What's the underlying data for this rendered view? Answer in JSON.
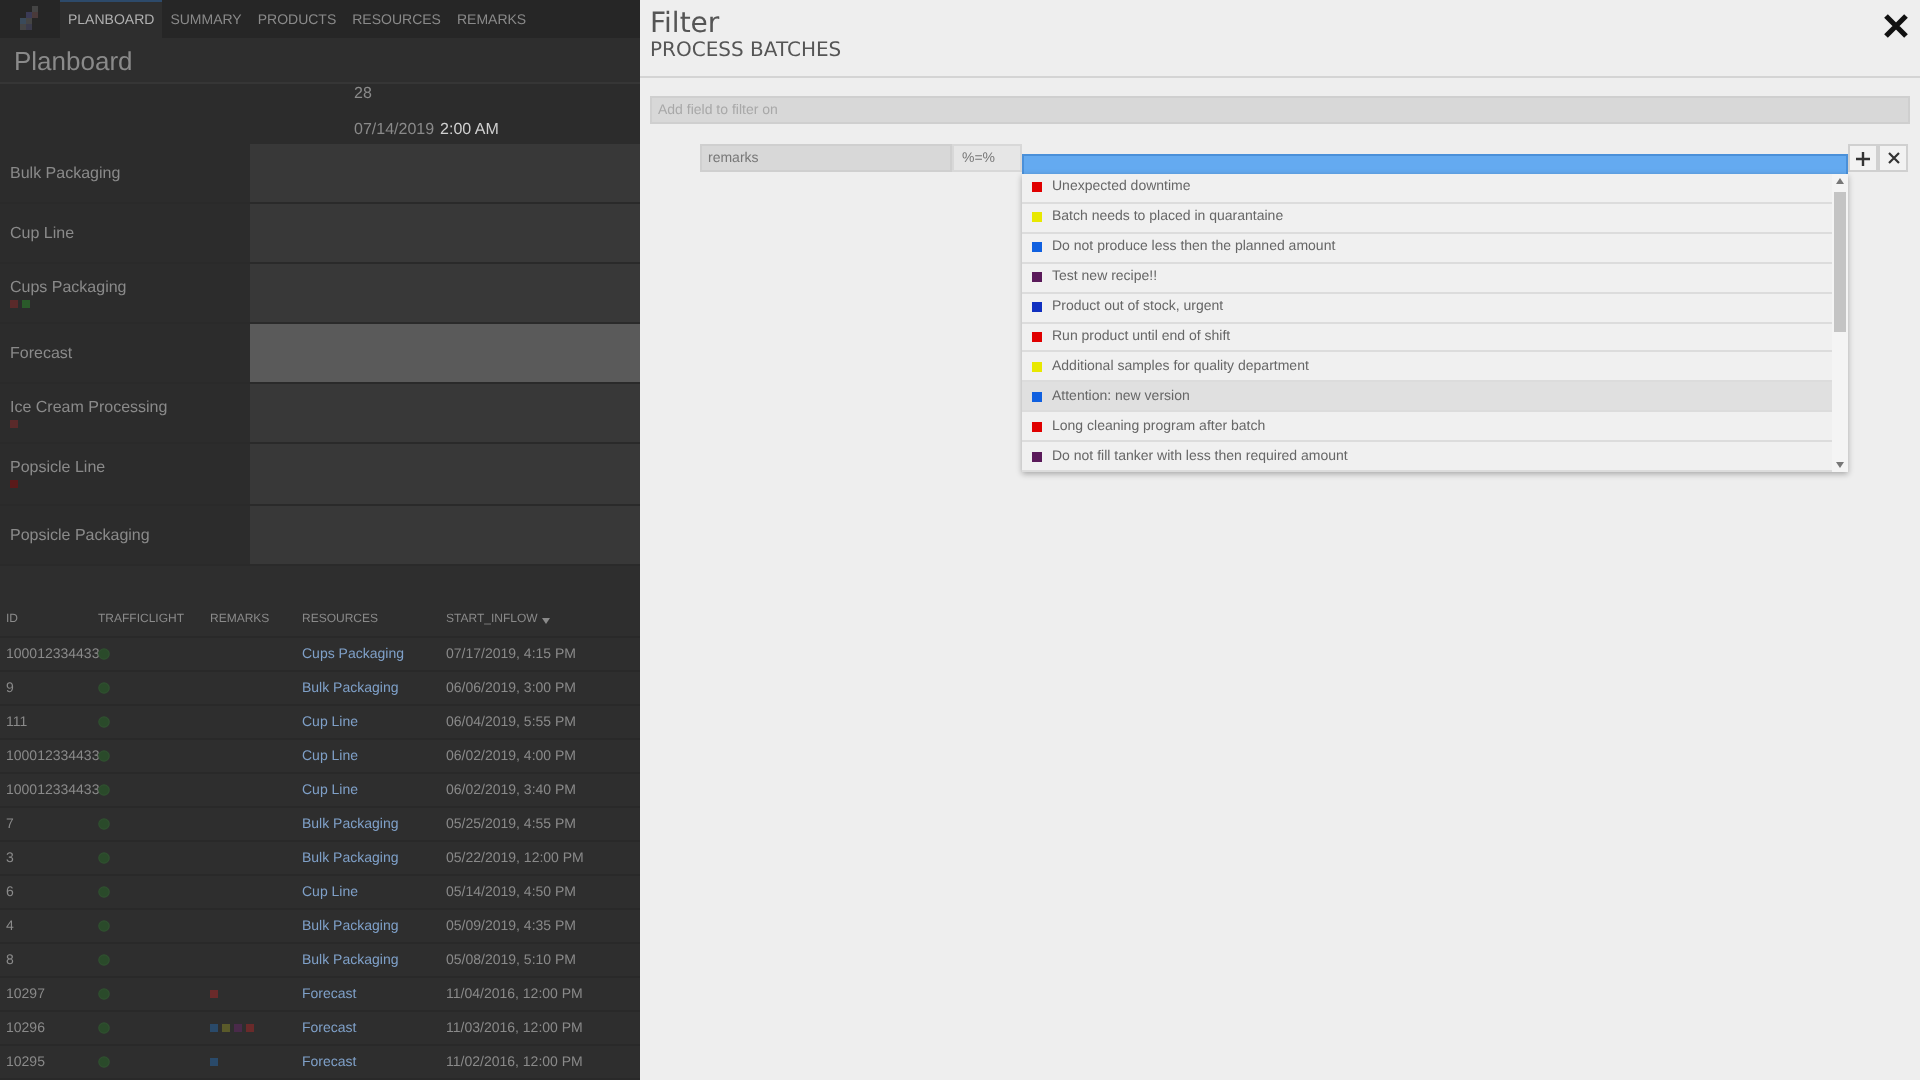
{
  "app": {
    "tabs": [
      {
        "label": "PLANBOARD",
        "selected": true
      },
      {
        "label": "SUMMARY",
        "selected": false
      },
      {
        "label": "PRODUCTS",
        "selected": false
      },
      {
        "label": "RESOURCES",
        "selected": false
      },
      {
        "label": "REMARKS",
        "selected": false
      }
    ],
    "title": "Planboard",
    "timeline": {
      "day": "28",
      "date": "07/14/2019",
      "time": "2:00 AM"
    },
    "resources": [
      {
        "name": "Bulk Packaging",
        "highlighted": false
      },
      {
        "name": "Cup Line",
        "highlighted": false
      },
      {
        "name": "Cups Packaging",
        "highlighted": false,
        "marks": [
          {
            "color": "#5a2a2a"
          },
          {
            "color": "#2a5a2a"
          }
        ]
      },
      {
        "name": "Forecast",
        "highlighted": true
      },
      {
        "name": "Ice Cream Processing",
        "highlighted": false,
        "marks": [
          {
            "color": "#5a2a2a"
          }
        ]
      },
      {
        "name": "Popsicle Line",
        "highlighted": false,
        "marks": [
          {
            "color": "#5a1a1a"
          }
        ]
      },
      {
        "name": "Popsicle Packaging",
        "highlighted": false
      }
    ],
    "table": {
      "columns": [
        {
          "label": "ID",
          "sorted": false
        },
        {
          "label": "TRAFFICLIGHT",
          "sorted": false
        },
        {
          "label": "REMARKS",
          "sorted": false
        },
        {
          "label": "RESOURCES",
          "sorted": false
        },
        {
          "label": "START_INFLOW",
          "sorted": true
        }
      ],
      "rows": [
        {
          "id": "100012334433",
          "remarks": [],
          "resource": "Cups Packaging",
          "start": "07/17/2019, 4:15 PM"
        },
        {
          "id": "9",
          "remarks": [],
          "resource": "Bulk Packaging",
          "start": "06/06/2019, 3:00 PM"
        },
        {
          "id": "111",
          "remarks": [],
          "resource": "Cup Line",
          "start": "06/04/2019, 5:55 PM"
        },
        {
          "id": "100012334433",
          "remarks": [],
          "resource": "Cup Line",
          "start": "06/02/2019, 4:00 PM"
        },
        {
          "id": "100012334433",
          "remarks": [],
          "resource": "Cup Line",
          "start": "06/02/2019, 3:40 PM"
        },
        {
          "id": "7",
          "remarks": [],
          "resource": "Bulk Packaging",
          "start": "05/25/2019, 4:55 PM"
        },
        {
          "id": "3",
          "remarks": [],
          "resource": "Bulk Packaging",
          "start": "05/22/2019, 12:00 PM"
        },
        {
          "id": "6",
          "remarks": [],
          "resource": "Cup Line",
          "start": "05/14/2019, 4:50 PM"
        },
        {
          "id": "4",
          "remarks": [],
          "resource": "Bulk Packaging",
          "start": "05/09/2019, 4:35 PM"
        },
        {
          "id": "8",
          "remarks": [],
          "resource": "Bulk Packaging",
          "start": "05/08/2019, 5:10 PM"
        },
        {
          "id": "10297",
          "remarks": [
            {
              "color": "#6a2a2a"
            }
          ],
          "resource": "Forecast",
          "start": "11/04/2016, 12:00 PM"
        },
        {
          "id": "10296",
          "remarks": [
            {
              "color": "#2a4a6a"
            },
            {
              "color": "#5a5a2a"
            },
            {
              "color": "#4a2a4a"
            },
            {
              "color": "#6a2a2a"
            }
          ],
          "resource": "Forecast",
          "start": "11/03/2016, 12:00 PM"
        },
        {
          "id": "10295",
          "remarks": [
            {
              "color": "#2a4a6a"
            }
          ],
          "resource": "Forecast",
          "start": "11/02/2016, 12:00 PM"
        }
      ]
    }
  },
  "filter": {
    "title": "Filter",
    "subtitle": "PROCESS BATCHES",
    "add_field": {
      "placeholder": "Add field to filter on"
    },
    "condition": {
      "field": "remarks",
      "operator": "%=%"
    },
    "options": [
      {
        "label": "Unexpected downtime",
        "color": "#e00000",
        "selected": false
      },
      {
        "label": "Batch needs to placed in quarantaine",
        "color": "#e8e800",
        "selected": false
      },
      {
        "label": "Do not produce less then the planned amount",
        "color": "#1060e0",
        "selected": false
      },
      {
        "label": "Test new recipe!!",
        "color": "#5a1a5a",
        "selected": false
      },
      {
        "label": "Product out of stock, urgent",
        "color": "#1030c0",
        "selected": false
      },
      {
        "label": "Run product until end of shift",
        "color": "#e00000",
        "selected": false
      },
      {
        "label": "Additional samples for quality department",
        "color": "#e8e800",
        "selected": false
      },
      {
        "label": "Attention: new version",
        "color": "#1060e0",
        "selected": true
      },
      {
        "label": "Long cleaning program after batch",
        "color": "#e00000",
        "selected": false
      },
      {
        "label": "Do not fill tanker with less then required amount",
        "color": "#5a1a5a",
        "selected": false
      }
    ]
  }
}
